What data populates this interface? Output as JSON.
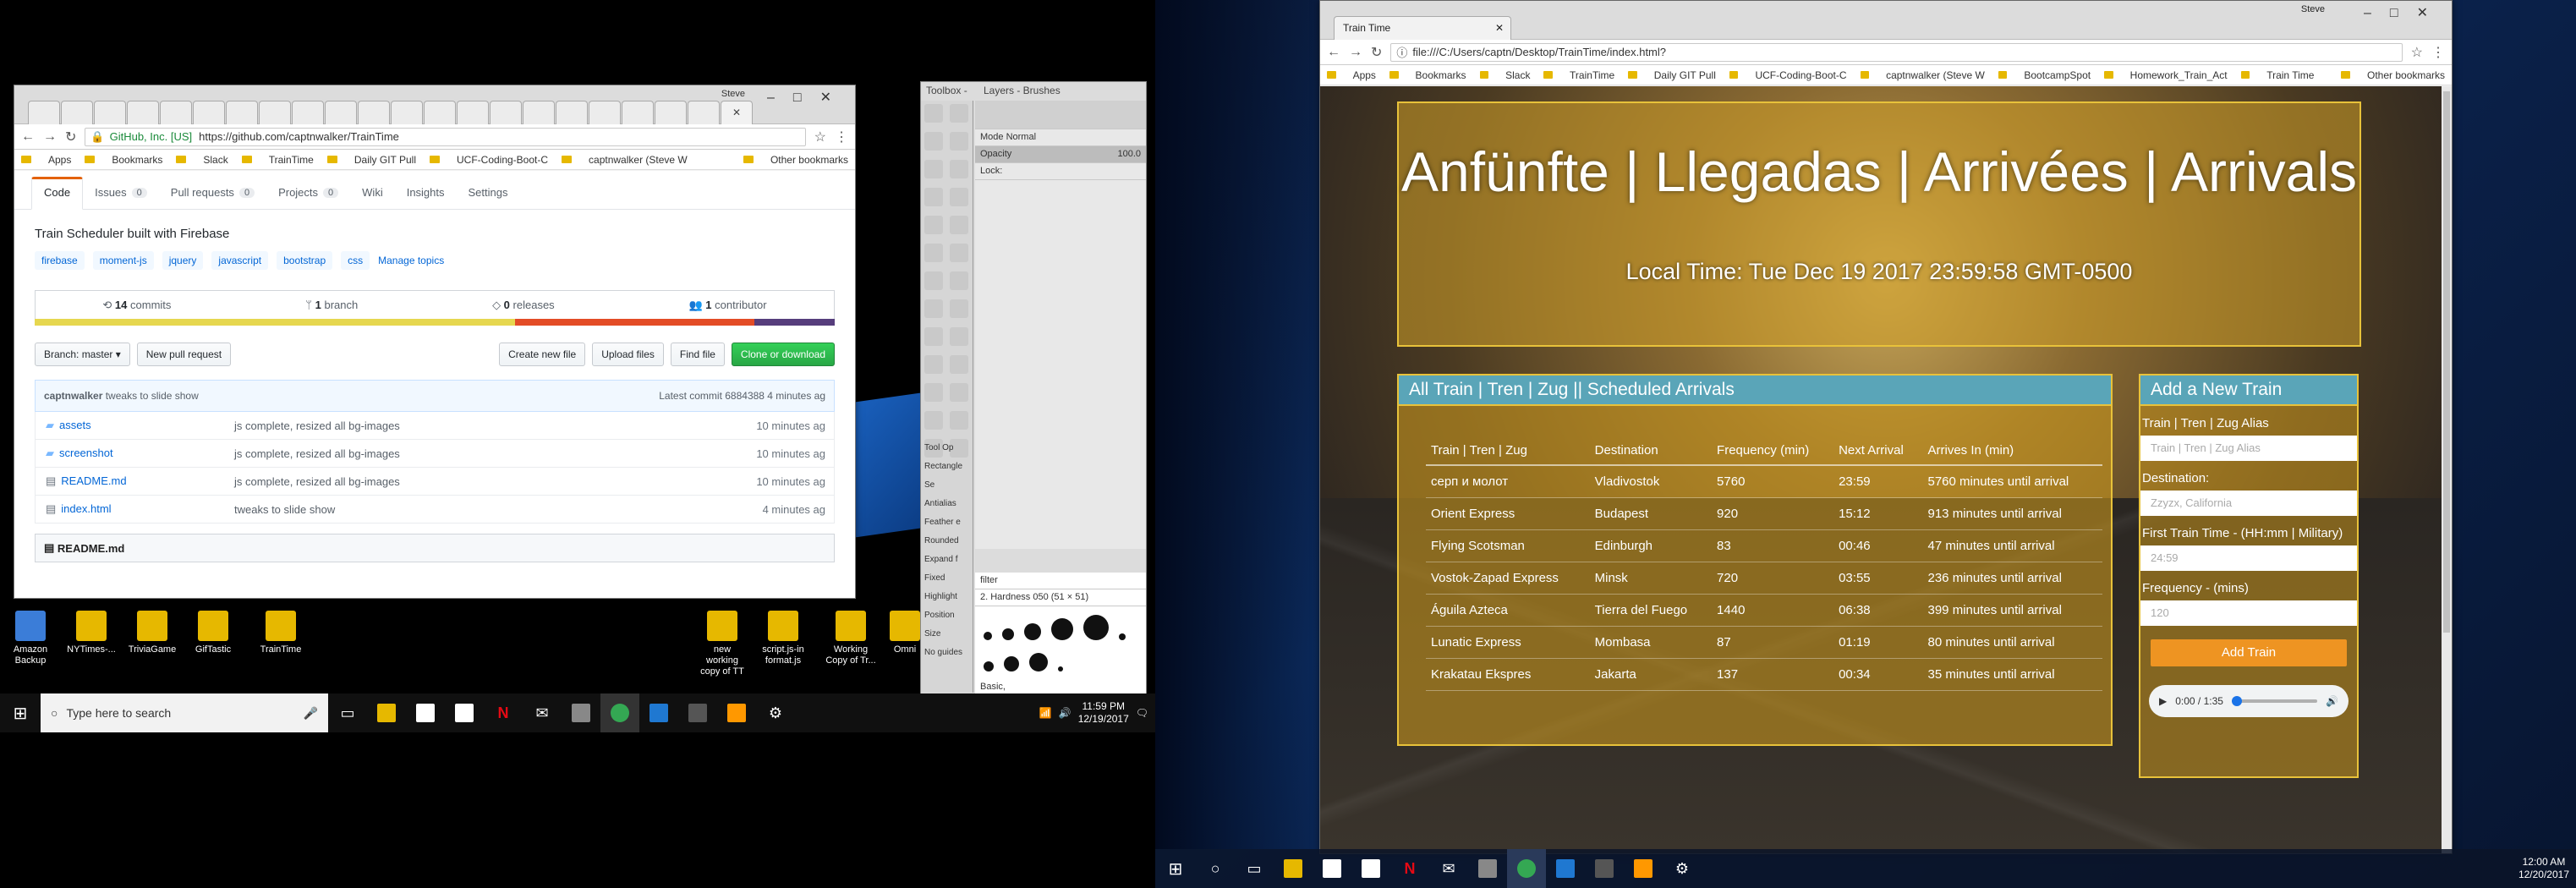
{
  "left_desktop": {
    "icons": [
      {
        "label": "Amazon Backup",
        "color": "#3b7dd8"
      },
      {
        "label": "NYTimes-...",
        "color": "#e6b800"
      },
      {
        "label": "TriviaGame",
        "color": "#e6b800"
      },
      {
        "label": "GifTastic",
        "color": "#e6b800"
      },
      {
        "label": "TrainTime",
        "color": "#e6b800"
      },
      {
        "label": "new working copy of TT",
        "color": "#e6b800"
      },
      {
        "label": "script.js-in format.js",
        "color": "#e6b800"
      },
      {
        "label": "Working Copy of Tr...",
        "color": "#e6b800"
      },
      {
        "label": "Omni",
        "color": "#e6b800"
      }
    ]
  },
  "github": {
    "title_user": "Steve",
    "secure_label": "GitHub, Inc. [US]",
    "url": "https://github.com/captnwalker/TrainTime",
    "bookmarks": [
      "Apps",
      "Bookmarks",
      "Slack",
      "TrainTime",
      "Daily GIT Pull",
      "UCF-Coding-Boot-C",
      "captnwalker (Steve W"
    ],
    "other_bookmarks": "Other bookmarks",
    "tabs": [
      {
        "label": "Code",
        "count": ""
      },
      {
        "label": "Issues",
        "count": "0"
      },
      {
        "label": "Pull requests",
        "count": "0"
      },
      {
        "label": "Projects",
        "count": "0"
      },
      {
        "label": "Wiki",
        "count": ""
      },
      {
        "label": "Insights",
        "count": ""
      },
      {
        "label": "Settings",
        "count": ""
      }
    ],
    "description": "Train Scheduler built with Firebase",
    "topics": [
      "firebase",
      "moment-js",
      "jquery",
      "javascript",
      "bootstrap",
      "css"
    ],
    "manage_topics": "Manage topics",
    "stats": {
      "commits": "14",
      "commits_label": "commits",
      "branch": "1",
      "branch_label": "branch",
      "releases": "0",
      "releases_label": "releases",
      "contributors": "1",
      "contributors_label": "contributor"
    },
    "lang_colors": [
      "#e6d74f",
      "#e34c26",
      "#563d7c"
    ],
    "branch_label": "Branch: master ▾",
    "new_pr": "New pull request",
    "create_file": "Create new file",
    "upload": "Upload files",
    "find": "Find file",
    "clone": "Clone or download",
    "commit_user": "captnwalker",
    "commit_msg": "tweaks to slide show",
    "latest": "Latest commit 6884388 4 minutes ag",
    "files": [
      {
        "name": "assets",
        "msg": "js complete, resized all bg-images",
        "time": "10 minutes ag",
        "folder": true
      },
      {
        "name": "screenshot",
        "msg": "js complete, resized all bg-images",
        "time": "10 minutes ag",
        "folder": true
      },
      {
        "name": "README.md",
        "msg": "js complete, resized all bg-images",
        "time": "10 minutes ag",
        "folder": false
      },
      {
        "name": "index.html",
        "msg": "tweaks to slide show",
        "time": "4 minutes ag",
        "folder": false
      }
    ],
    "readme": "README.md"
  },
  "gimp": {
    "toolbox": "Toolbox - ...",
    "dock_title": "Layers - Brushes",
    "mode": "Mode  Normal",
    "opacity": "Opacity",
    "opacity_val": "100.0",
    "lock": "Lock:",
    "tool_options": "Tool Op",
    "rect_select": "Rectangle Se",
    "filter": "filter",
    "brush_name": "2. Hardness 050 (51 × 51)",
    "spacing": "Basic,",
    "position": "Position",
    "size": "Size",
    "guides": "No guides",
    "opts": [
      "Antialias",
      "Feather e",
      "Rounded",
      "Expand f",
      "Fixed",
      "Highlight"
    ]
  },
  "taskbar_left": {
    "search": "Type here to search",
    "time": "11:59 PM",
    "date": "12/19/2017"
  },
  "taskbar_right": {
    "time": "12:00 AM",
    "date": "12/20/2017"
  },
  "traintime": {
    "user": "Steve",
    "tab": "Train Time",
    "url": "file:///C:/Users/captn/Desktop/TrainTime/index.html?",
    "bookmarks": [
      "Apps",
      "Bookmarks",
      "Slack",
      "TrainTime",
      "Daily GIT Pull",
      "UCF-Coding-Boot-C",
      "captnwalker (Steve W",
      "BootcampSpot",
      "Homework_Train_Act",
      "Train Time"
    ],
    "other_bookmarks": "Other bookmarks",
    "heading": "Anfünfte | Llegadas | Arrivées | Arrivals",
    "local_time": "Local Time: Tue Dec 19 2017 23:59:58 GMT-0500",
    "sched_title": "All Train | Tren | Zug || Scheduled Arrivals",
    "columns": [
      "Train | Tren | Zug",
      "Destination",
      "Frequency (min)",
      "Next Arrival",
      "Arrives In (min)"
    ],
    "rows": [
      [
        "серп и молот",
        "Vladivostok",
        "5760",
        "23:59",
        "5760 minutes until arrival"
      ],
      [
        "Orient Express",
        "Budapest",
        "920",
        "15:12",
        "913 minutes until arrival"
      ],
      [
        "Flying Scotsman",
        "Edinburgh",
        "83",
        "00:46",
        "47 minutes until arrival"
      ],
      [
        "Vostok-Zapad Express",
        "Minsk",
        "720",
        "03:55",
        "236 minutes until arrival"
      ],
      [
        "Águila Azteca",
        "Tierra del Fuego",
        "1440",
        "06:38",
        "399 minutes until arrival"
      ],
      [
        "Lunatic Express",
        "Mombasa",
        "87",
        "01:19",
        "80 minutes until arrival"
      ],
      [
        "Krakatau Ekspres",
        "Jakarta",
        "137",
        "00:34",
        "35 minutes until arrival"
      ]
    ],
    "add_title": "Add a New Train",
    "f_name": "Train | Tren | Zug Alias",
    "f_name_ph": "Train | Tren | Zug Alias",
    "f_dest": "Destination:",
    "f_dest_ph": "Zzyzx, California",
    "f_first": "First Train Time - (HH:mm | Military)",
    "f_first_ph": "24:59",
    "f_freq": "Frequency - (mins)",
    "f_freq_ph": "120",
    "add_btn": "Add Train",
    "audio_time": "0:00 / 1:35"
  }
}
